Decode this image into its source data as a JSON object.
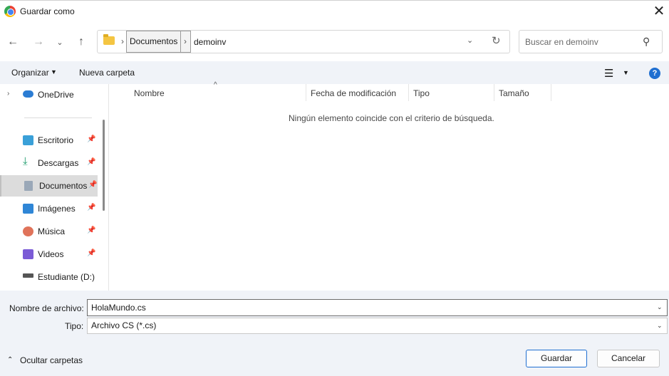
{
  "window": {
    "title": "Guardar como"
  },
  "address": {
    "breadcrumb": [
      "Documentos",
      "demoinv"
    ],
    "search_placeholder": "Buscar en demoinv"
  },
  "toolbar": {
    "organize_label": "Organizar",
    "new_folder_label": "Nueva carpeta"
  },
  "sidebar": {
    "items": [
      {
        "label": "OneDrive",
        "icon": "cloud-icon"
      },
      {
        "label": "Escritorio",
        "icon": "desktop-icon"
      },
      {
        "label": "Descargas",
        "icon": "download-icon"
      },
      {
        "label": "Documentos",
        "icon": "documents-icon",
        "selected": true
      },
      {
        "label": "Imágenes",
        "icon": "pictures-icon"
      },
      {
        "label": "Música",
        "icon": "music-icon"
      },
      {
        "label": "Videos",
        "icon": "videos-icon"
      },
      {
        "label": "Estudiante (D:)",
        "icon": "drive-icon"
      }
    ]
  },
  "filelist": {
    "columns": [
      "Nombre",
      "Fecha de modificación",
      "Tipo",
      "Tamaño"
    ],
    "empty_message": "Ningún elemento coincide con el criterio de búsqueda."
  },
  "save_panel": {
    "filename_label": "Nombre de archivo:",
    "filename_value": "HolaMundo.cs",
    "type_label": "Tipo:",
    "type_value": "Archivo CS (*.cs)",
    "hide_folders_label": "Ocultar carpetas",
    "save_label": "Guardar",
    "cancel_label": "Cancelar"
  },
  "colors": {
    "accent": "#1f6fd1",
    "toolbar_bg": "#f0f3f8",
    "selected_bg": "#dcdcdc"
  }
}
